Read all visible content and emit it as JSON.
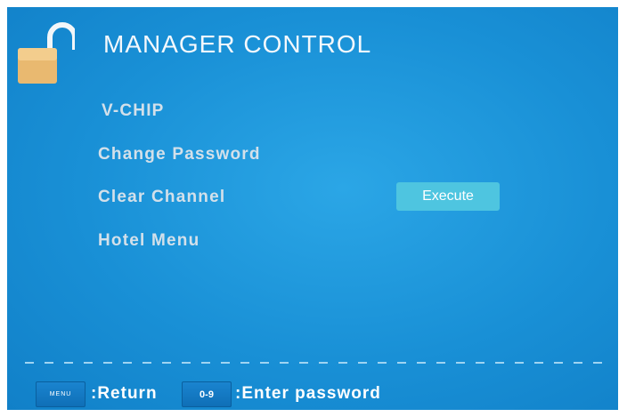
{
  "header": {
    "title": "MANAGER CONTROL",
    "icon": "lock-icon"
  },
  "menu": {
    "items": [
      {
        "label": "V-CHIP"
      },
      {
        "label": "Change Password"
      },
      {
        "label": "Clear Channel"
      },
      {
        "label": "Hotel  Menu"
      }
    ],
    "execute_label": "Execute"
  },
  "footer": {
    "keys": [
      {
        "key": "MENU",
        "hint": ":Return"
      },
      {
        "key": "0-9",
        "hint": ":Enter password"
      }
    ]
  },
  "colors": {
    "background": "#1990d6",
    "accent": "#4ec5e0",
    "text": "#ffffff",
    "menu_text": "#d3e0ea"
  }
}
